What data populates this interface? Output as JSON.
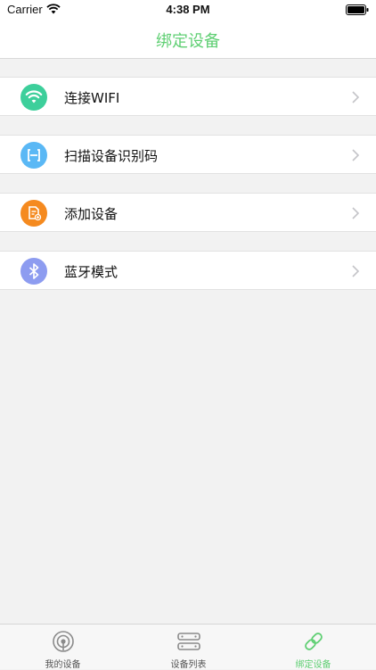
{
  "status_bar": {
    "carrier": "Carrier",
    "time": "4:38 PM"
  },
  "nav": {
    "title": "绑定设备"
  },
  "menu": [
    {
      "label": "连接WIFI",
      "icon": "wifi-icon",
      "icon_color": "#3dcf9b"
    },
    {
      "label": "扫描设备识别码",
      "icon": "scan-icon",
      "icon_color": "#5ab8f5"
    },
    {
      "label": "添加设备",
      "icon": "add-device-icon",
      "icon_color": "#f58a1f"
    },
    {
      "label": "蓝牙模式",
      "icon": "bluetooth-icon",
      "icon_color": "#8d9cf0"
    }
  ],
  "tab_bar": {
    "tabs": [
      {
        "label": "我的设备",
        "icon": "my-device-icon"
      },
      {
        "label": "设备列表",
        "icon": "device-list-icon"
      },
      {
        "label": "绑定设备",
        "icon": "link-icon",
        "active": true
      }
    ]
  },
  "colors": {
    "accent": "#5fcf73",
    "background": "#f2f2f2"
  }
}
